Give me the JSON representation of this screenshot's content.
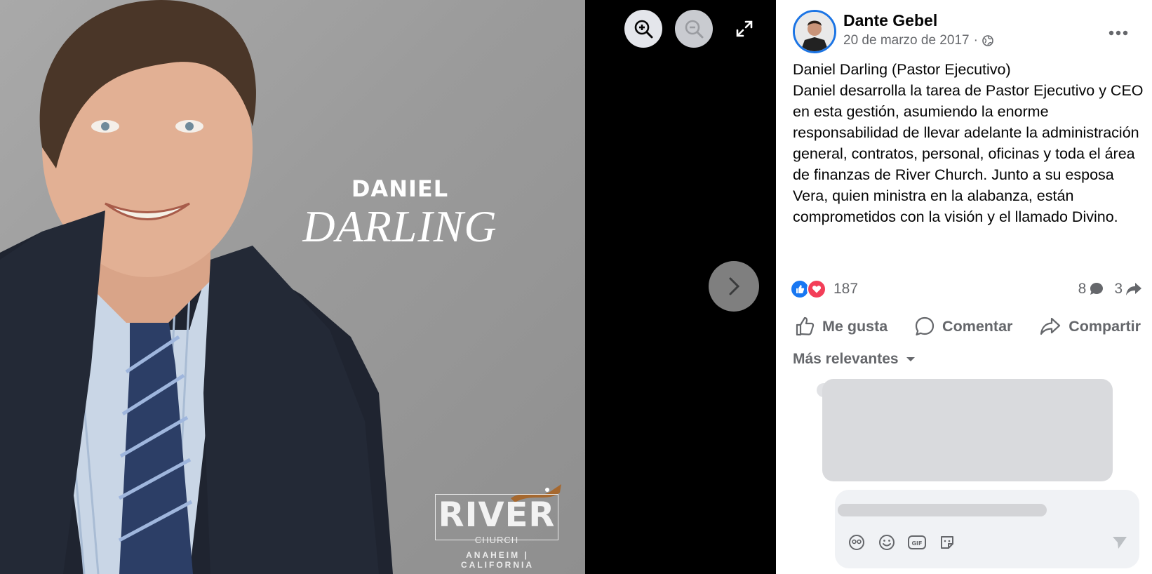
{
  "photo": {
    "name_first": "DANIEL",
    "name_last": "DARLING",
    "logo_word": "RIVER",
    "logo_sub": "CHURCH",
    "logo_city": "ANAHEIM | CALIFORNIA"
  },
  "viewer_tools": {
    "zoom_in_icon": "zoom-in-icon",
    "zoom_out_icon": "zoom-out-icon",
    "expand_icon": "expand-icon",
    "next_icon": "chevron-right-icon"
  },
  "post": {
    "author": "Dante Gebel",
    "date": "20 de marzo de 2017",
    "separator": "·",
    "text": "Daniel Darling (Pastor Ejecutivo)\nDaniel desarrolla la tarea de Pastor Ejecutivo y CEO en esta gestión, asumiendo la enorme responsabilidad de llevar adelante la administración general, contratos, personal, oficinas y toda el área de finanzas de River Church. Junto a su esposa Vera, quien ministra en la alabanza, están comprometidos con la visión y el llamado Divino.",
    "reactions_count": "187",
    "comments_count": "8",
    "shares_count": "3"
  },
  "actions": {
    "like": "Me gusta",
    "comment": "Comentar",
    "share": "Compartir"
  },
  "comments": {
    "sort_label": "Más relevantes"
  },
  "colors": {
    "accent": "#1877f2",
    "love": "#f33e58",
    "secondary_text": "#65676b"
  }
}
